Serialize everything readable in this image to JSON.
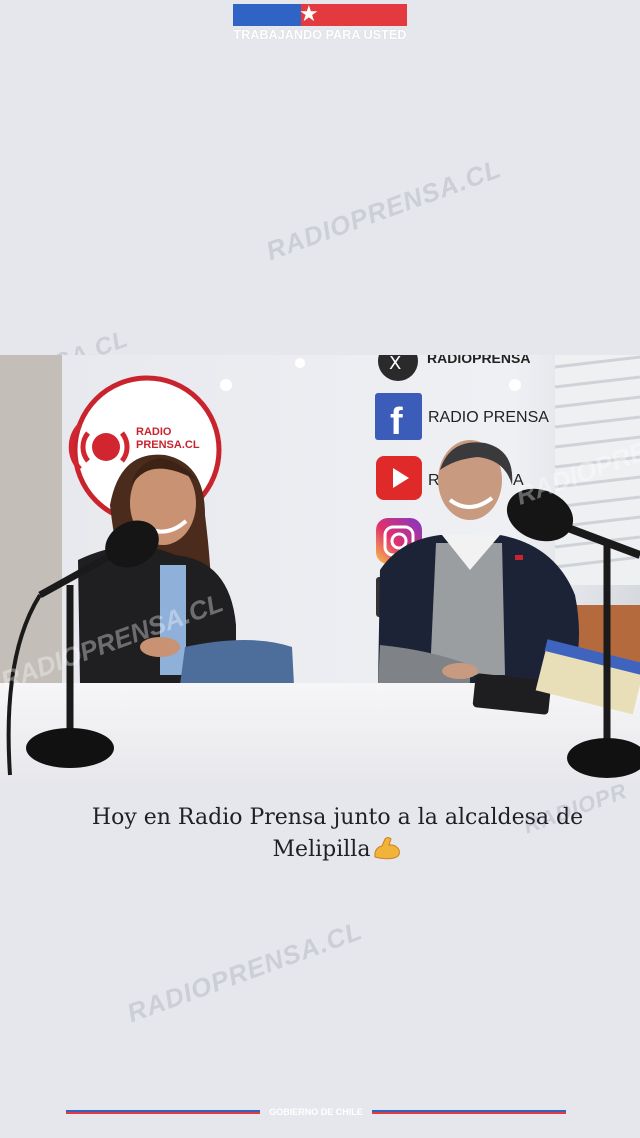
{
  "banner": {
    "tagline": "TRABAJANDO PARA USTED",
    "star_icon": "star-icon",
    "colors": {
      "blue": "#2f63c4",
      "red": "#e23a3f"
    }
  },
  "watermark": {
    "text": "RADIOPRENSA.CL",
    "text_partial_left": "RENSA.CL",
    "text_partial_right": "RADIOPR"
  },
  "photo": {
    "logo_line1": "RADIO",
    "logo_line2": "PRENSA.CL",
    "social_x": "RADIOPRENSA",
    "social_facebook": "RADIO PRENSA",
    "social_youtube": "RA",
    "social_youtube_tail": "A",
    "icons": [
      "x-icon",
      "facebook-icon",
      "youtube-icon",
      "instagram-icon",
      "radio-wave-icon",
      "microphone-icon"
    ]
  },
  "caption": {
    "line1": "Hoy en Radio Prensa junto a la alcaldesa de",
    "line2": "Melipilla",
    "emoji": "flexed-biceps-icon"
  },
  "footer": {
    "text_a": "GOBIERNO",
    "text_b": "DE",
    "text_c": "CHILE"
  }
}
